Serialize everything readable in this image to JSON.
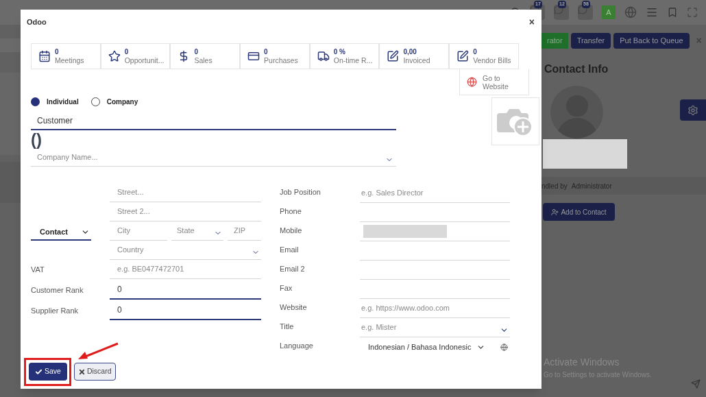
{
  "background": {
    "badges": [
      "17",
      "12",
      "58"
    ],
    "avatar_letter": "A",
    "buttons": [
      "rator",
      "Transfer",
      "Put Back to Queue"
    ],
    "close": "×",
    "panel_title": "Contact Info",
    "handled_label": "ndled by",
    "handled_value": "Administrator",
    "add_button": "Add to Contact",
    "os_notice": {
      "title": "Activate Windows",
      "subtitle": "Go to Settings to activate Windows."
    }
  },
  "dialog": {
    "title": "Odoo",
    "close": "×",
    "stats": [
      {
        "value": "0",
        "label": "Meetings"
      },
      {
        "value": "0",
        "label": "Opportunit..."
      },
      {
        "value": "0",
        "label": "Sales"
      },
      {
        "value": "0",
        "label": "Purchases"
      },
      {
        "value": "0 %",
        "label": "On-time R..."
      },
      {
        "value": "0,00",
        "label": "Invoiced"
      },
      {
        "value": "0",
        "label": "Vendor Bills"
      }
    ],
    "website_button": "Go to Website",
    "company_type": [
      {
        "label": "Individual",
        "selected": true
      },
      {
        "label": "Company",
        "selected": false
      }
    ],
    "name_field": {
      "value": "Customer"
    },
    "parens": "()",
    "company_field": {
      "placeholder": "Company Name..."
    },
    "address_type": "Contact",
    "address": {
      "street": {
        "placeholder": "Street..."
      },
      "street2": {
        "placeholder": "Street 2..."
      },
      "city": {
        "placeholder": "City"
      },
      "state": {
        "placeholder": "State"
      },
      "zip": {
        "placeholder": "ZIP"
      },
      "country": {
        "placeholder": "Country"
      }
    },
    "left_fields": [
      {
        "label": "VAT",
        "placeholder": "e.g. BE0477472701",
        "kind": "text"
      },
      {
        "label": "Customer Rank",
        "value": "0",
        "kind": "number"
      },
      {
        "label": "Supplier Rank",
        "value": "0",
        "kind": "number"
      }
    ],
    "right_fields": [
      {
        "label": "Job Position",
        "placeholder": "e.g. Sales Director",
        "kind": "text"
      },
      {
        "label": "Phone",
        "kind": "text"
      },
      {
        "label": "Mobile",
        "kind": "redacted"
      },
      {
        "label": "Email",
        "kind": "text"
      },
      {
        "label": "Email 2",
        "kind": "text"
      },
      {
        "label": "Fax",
        "kind": "text"
      },
      {
        "label": "Website",
        "placeholder": "e.g. https://www.odoo.com",
        "kind": "text"
      },
      {
        "label": "Title",
        "placeholder": "e.g. Mister",
        "kind": "select"
      },
      {
        "label": "Language",
        "value": "Indonesian / Bahasa Indonesic",
        "kind": "language"
      }
    ],
    "buttons": [
      {
        "label": "Save",
        "kind": "primary"
      },
      {
        "label": "Discard",
        "kind": "secondary"
      }
    ]
  }
}
